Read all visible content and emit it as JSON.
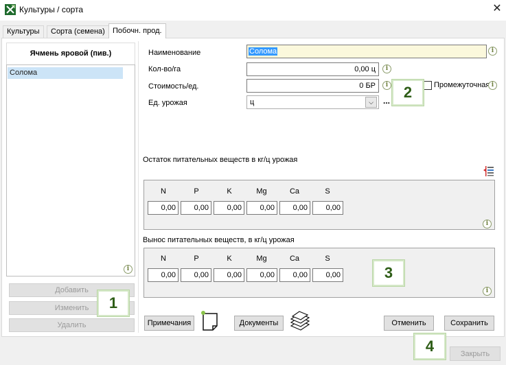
{
  "window": {
    "title": "Культуры / сорта",
    "close_glyph": "✕"
  },
  "tabs": [
    "Культуры",
    "Сорта (семена)",
    "Побочн. прод."
  ],
  "left_panel": {
    "header": "Ячмень яровой (пив.)",
    "items": [
      "Солома"
    ],
    "buttons": {
      "add": "Добавить",
      "edit": "Изменить",
      "delete": "Удалить"
    }
  },
  "form": {
    "name_label": "Наименование",
    "name_value": "Солома",
    "qty_label": "Кол-во/га",
    "qty_value": "0,00 ц",
    "cost_label": "Стоимость/ед.",
    "cost_value": "0 БР",
    "checkbox_label": "Промежуточная",
    "unit_label": "Ед. урожая",
    "unit_value": "ц",
    "dots": "...",
    "info_glyph": "i"
  },
  "nutrients_remaining": {
    "title": "Остаток питательных веществ в кг/ц урожая",
    "headers": [
      "N",
      "P",
      "K",
      "Mg",
      "Ca",
      "S"
    ],
    "values": [
      "0,00",
      "0,00",
      "0,00",
      "0,00",
      "0,00",
      "0,00"
    ]
  },
  "nutrients_removal": {
    "title": "Вынос питательных веществ, в кг/ц урожая",
    "headers": [
      "N",
      "P",
      "K",
      "Mg",
      "Ca",
      "S"
    ],
    "values": [
      "0,00",
      "0,00",
      "0,00",
      "0,00",
      "0,00",
      "0,00"
    ]
  },
  "actions": {
    "notes": "Примечания",
    "documents": "Документы",
    "cancel": "Отменить",
    "save": "Сохранить",
    "close": "Закрыть"
  },
  "badges": [
    "1",
    "2",
    "3",
    "4"
  ],
  "colors": {
    "selection": "#cce4f7",
    "name_bg": "#fbf8dc",
    "badge_text": "#2e5d17"
  }
}
